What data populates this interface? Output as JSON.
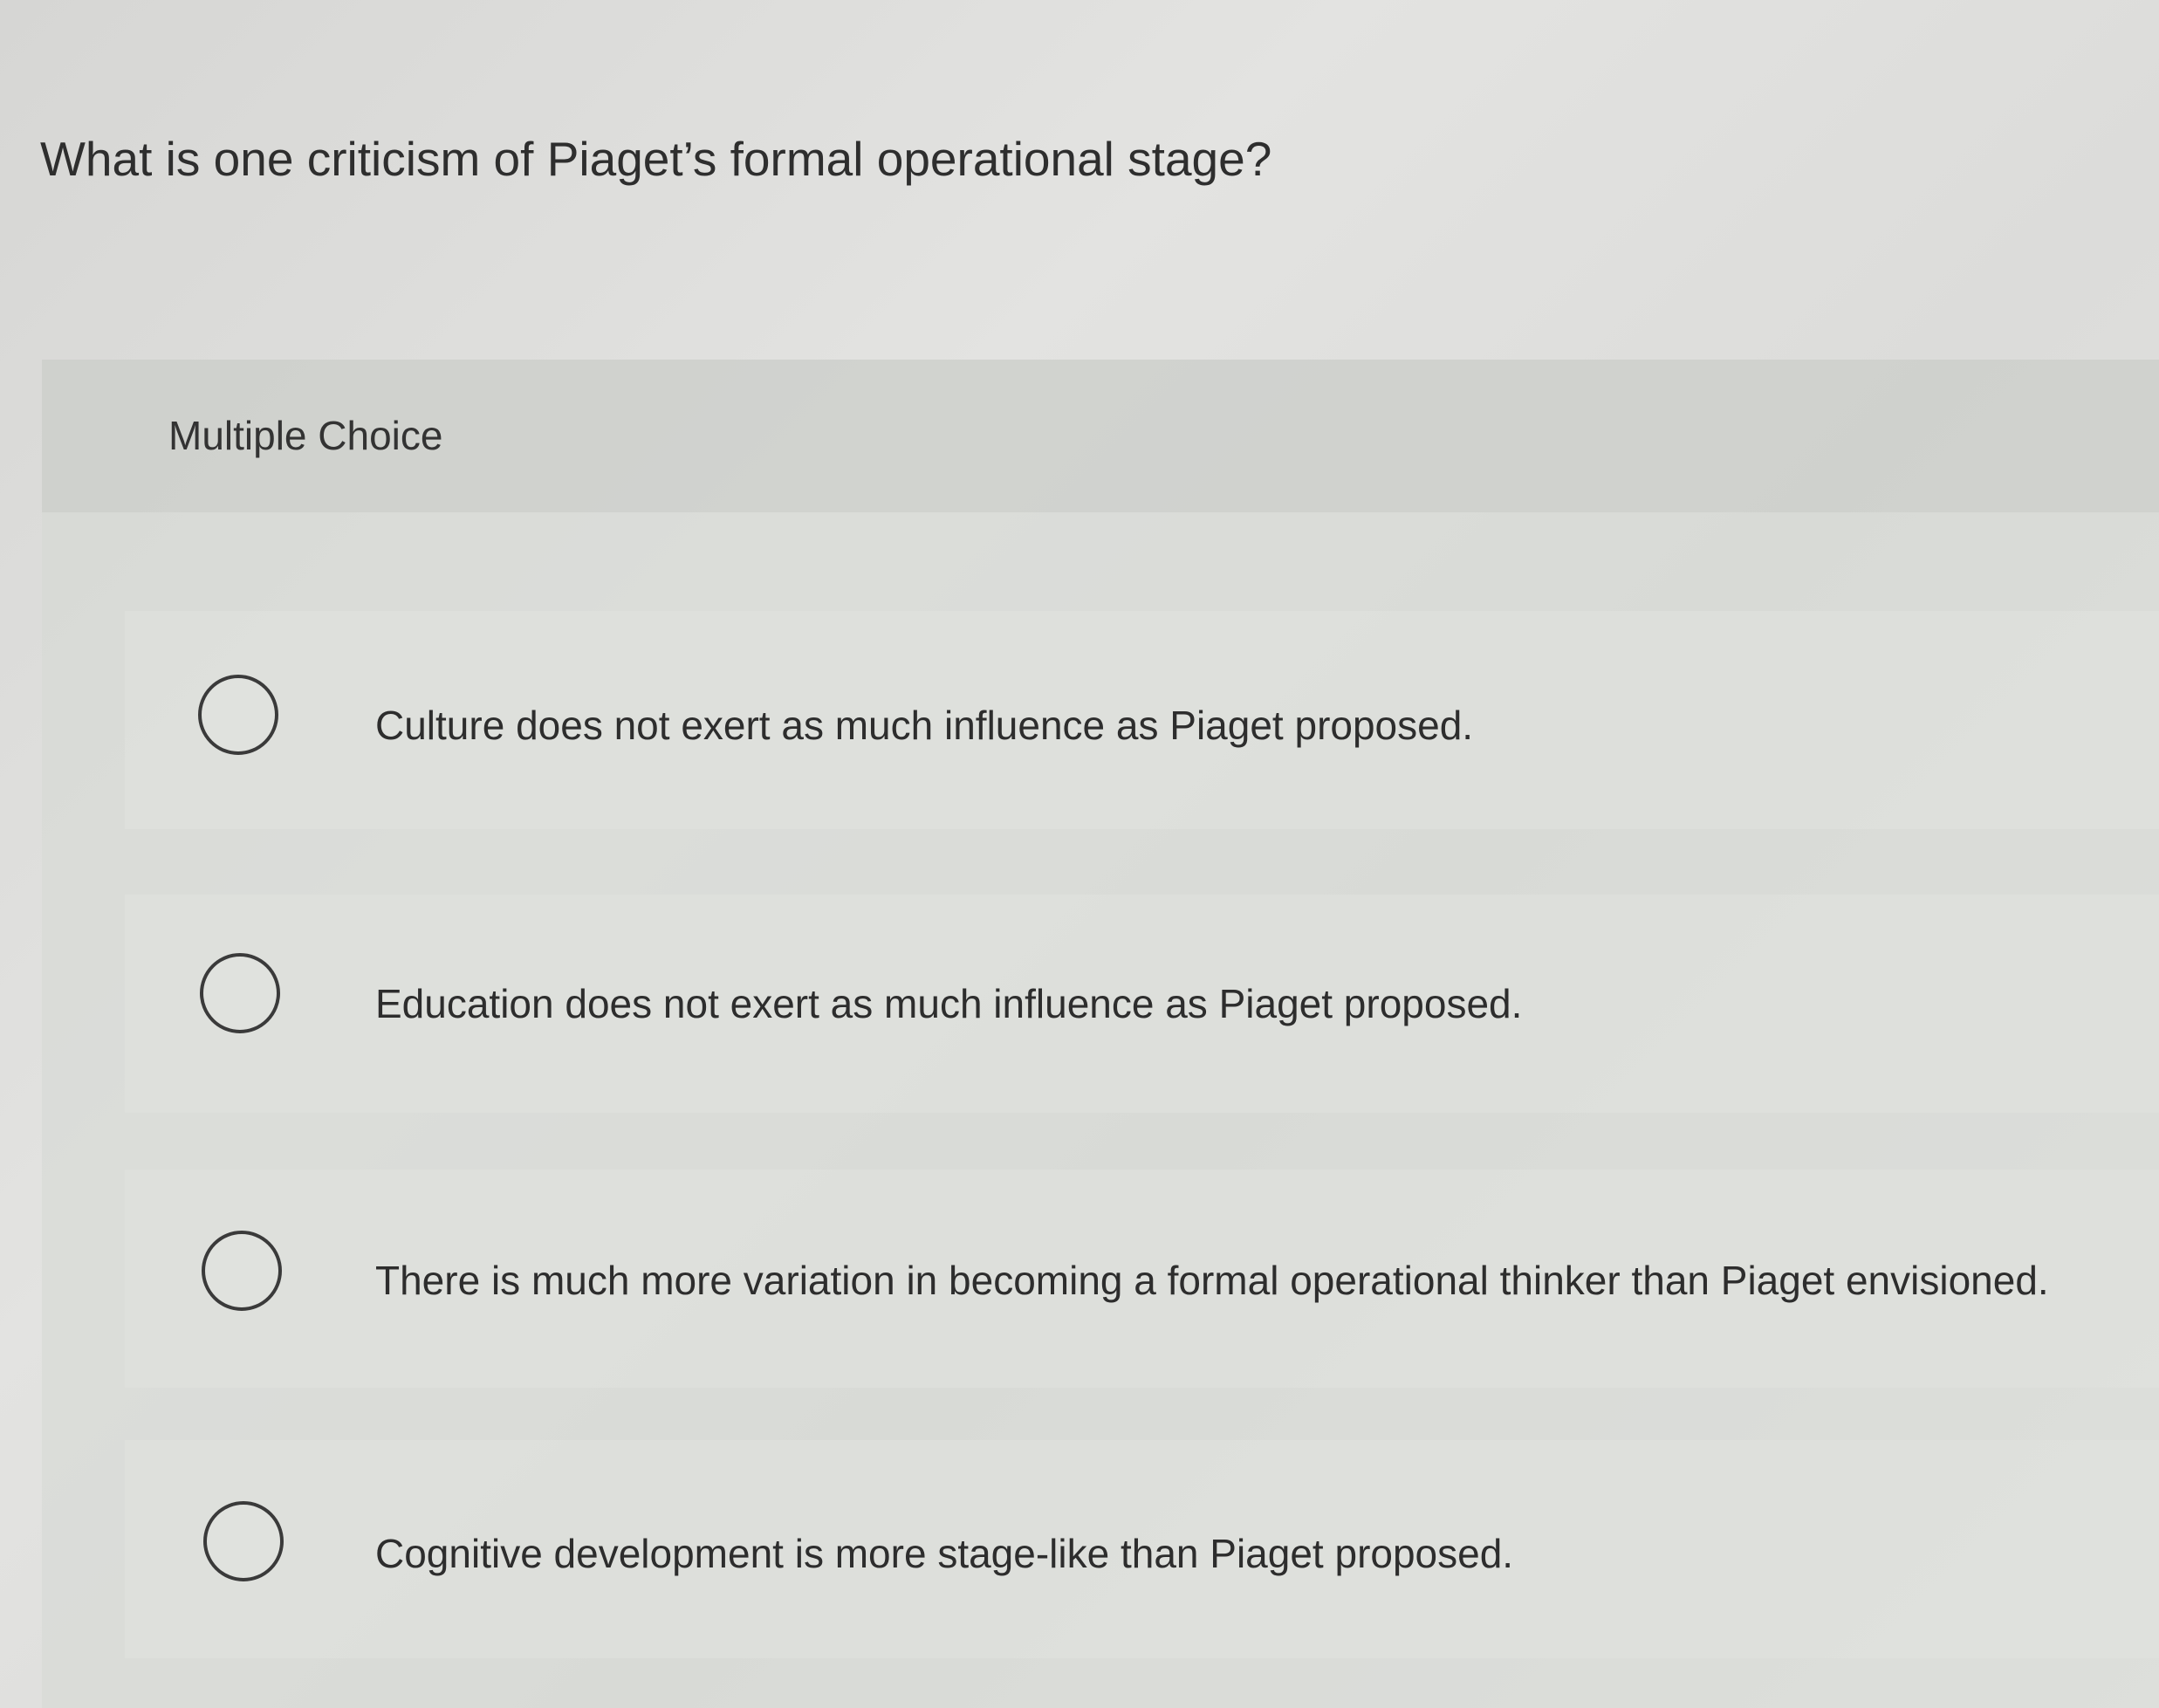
{
  "question": {
    "text": "What is one criticism of Piaget’s formal operational stage?"
  },
  "question_type": {
    "label": "Multiple Choice"
  },
  "options": [
    {
      "label": "Culture does not exert as much influence as Piaget proposed."
    },
    {
      "label": "Education does not exert as much influence as Piaget proposed."
    },
    {
      "label": "There is much more variation in becoming a formal operational thinker than Piaget envisioned."
    },
    {
      "label": "Cognitive development is more stage-like than Piaget proposed."
    }
  ]
}
